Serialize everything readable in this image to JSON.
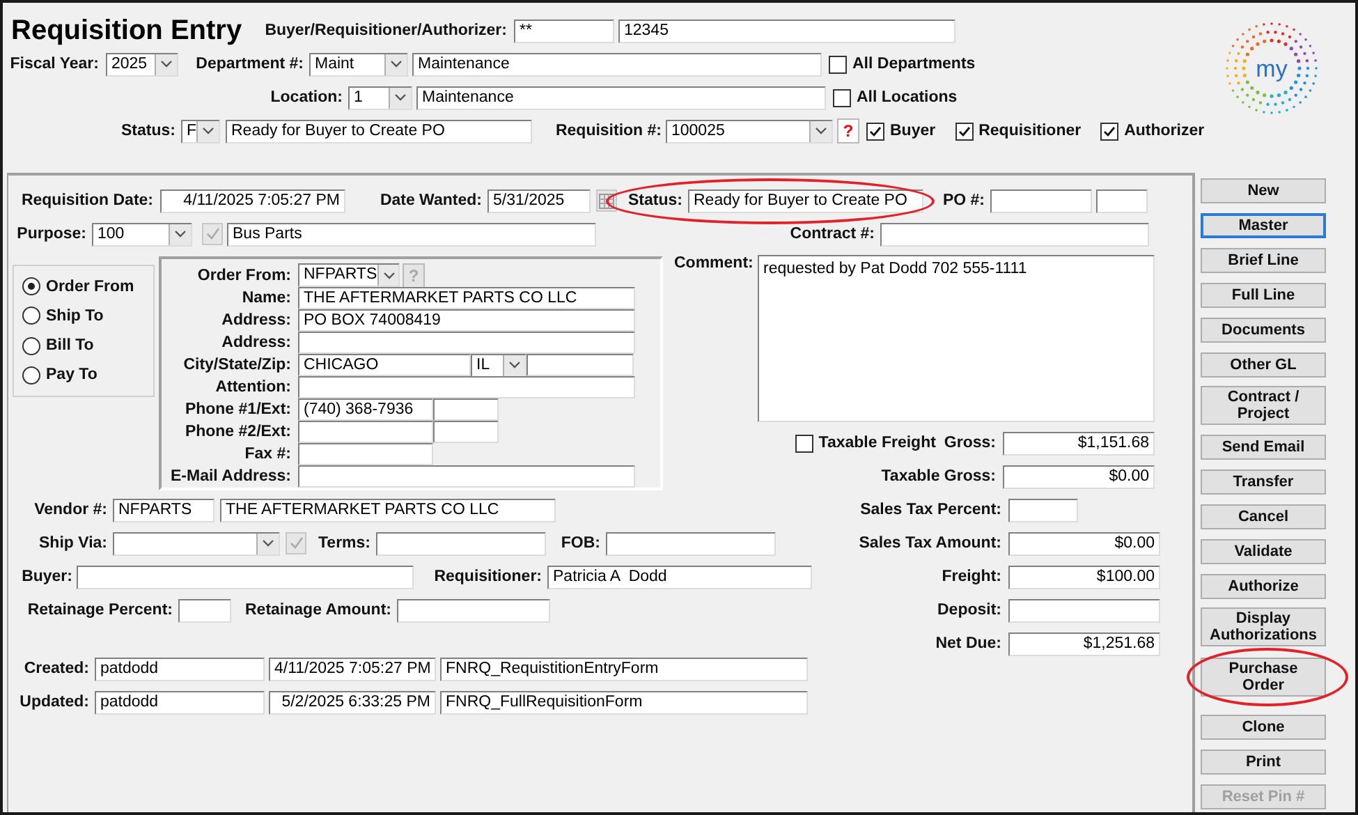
{
  "header": {
    "title": "Requisition Entry",
    "buyer": {
      "label": "Buyer/Requisitioner/Authorizer:",
      "code": "**",
      "id": "12345"
    },
    "fiscal_year": {
      "label": "Fiscal Year:",
      "value": "2025"
    },
    "department": {
      "label": "Department #:",
      "code": "Maint",
      "name": "Maintenance"
    },
    "all_departments": {
      "label": "All Departments",
      "checked": false
    },
    "location": {
      "label": "Location:",
      "code": "1",
      "name": "Maintenance"
    },
    "all_locations": {
      "label": "All Locations",
      "checked": false
    },
    "status": {
      "label": "Status:",
      "code": "F",
      "text": "Ready for Buyer to Create PO"
    },
    "requisition": {
      "label": "Requisition #:",
      "value": "100025",
      "help": "?"
    },
    "role_filters": [
      {
        "label": "Buyer",
        "checked": true
      },
      {
        "label": "Requisitioner",
        "checked": true
      },
      {
        "label": "Authorizer",
        "checked": true
      }
    ]
  },
  "logo": {
    "text": "my"
  },
  "form": {
    "requisition_date": {
      "label": "Requisition Date:",
      "value": "4/11/2025 7:05:27 PM"
    },
    "date_wanted": {
      "label": "Date Wanted:",
      "value": "5/31/2025"
    },
    "status": {
      "label": "Status:",
      "value": "Ready for Buyer to Create PO",
      "circled": true
    },
    "po": {
      "label": "PO #:"
    },
    "purpose": {
      "label": "Purpose:",
      "code": "100",
      "text": "Bus Parts"
    },
    "contract": {
      "label": "Contract #:"
    },
    "address_types": [
      {
        "label": "Order From",
        "selected": true
      },
      {
        "label": "Ship To",
        "selected": false
      },
      {
        "label": "Bill To",
        "selected": false
      },
      {
        "label": "Pay To",
        "selected": false
      }
    ],
    "address": {
      "order_from": {
        "label": "Order From:",
        "value": "NFPARTS",
        "help": "?"
      },
      "rows": [
        {
          "kind": "text",
          "label": "Name:",
          "value": "THE AFTERMARKET PARTS CO LLC"
        },
        {
          "kind": "text",
          "label": "Address:",
          "value": "PO BOX 74008419"
        },
        {
          "kind": "text",
          "label": "Address:"
        },
        {
          "kind": "city",
          "label": "City/State/Zip:",
          "city": "CHICAGO",
          "state": "IL"
        },
        {
          "kind": "text",
          "label": "Attention:"
        },
        {
          "kind": "phone",
          "label": "Phone #1/Ext:",
          "value": "(740) 368-7936"
        },
        {
          "kind": "phone",
          "label": "Phone #2/Ext:"
        },
        {
          "kind": "fax",
          "label": "Fax #:"
        },
        {
          "kind": "text",
          "label": "E-Mail Address:"
        }
      ]
    },
    "comment": {
      "label": "Comment:",
      "value": "requested by Pat Dodd 702 555-1111"
    },
    "taxable_freight": {
      "label": "Taxable Freight",
      "checked": false
    },
    "totals": [
      {
        "kind": "full",
        "label": "Gross:",
        "value": "$1,151.68"
      },
      {
        "kind": "full",
        "label": "Taxable Gross:",
        "value": "$0.00"
      },
      {
        "kind": "short",
        "label": "Sales Tax Percent:"
      },
      {
        "kind": "full",
        "label": "Sales Tax Amount:",
        "value": "$0.00"
      },
      {
        "kind": "full",
        "label": "Freight:",
        "value": "$100.00"
      },
      {
        "kind": "full",
        "label": "Deposit:"
      },
      {
        "kind": "full",
        "label": "Net Due:",
        "value": "$1,251.68"
      }
    ],
    "vendor": {
      "label": "Vendor #:",
      "code": "NFPARTS",
      "name": "THE AFTERMARKET PARTS CO LLC"
    },
    "ship_via": {
      "label": "Ship Via:"
    },
    "terms": {
      "label": "Terms:"
    },
    "fob": {
      "label": "FOB:"
    },
    "buyer": {
      "label": "Buyer:"
    },
    "requisitioner": {
      "label": "Requisitioner:",
      "value": "Patricia A  Dodd"
    },
    "retainage_percent": {
      "label": "Retainage Percent:"
    },
    "retainage_amount": {
      "label": "Retainage Amount:"
    },
    "audit": [
      {
        "label": "Created:",
        "user": "patdodd",
        "time": "4/11/2025 7:05:27 PM",
        "form": "FNRQ_RequistitionEntryForm"
      },
      {
        "label": "Updated:",
        "user": "patdodd",
        "time": "5/2/2025 6:33:25 PM",
        "form": "FNRQ_FullRequisitionForm"
      }
    ]
  },
  "buttons": [
    {
      "label": "New",
      "focused": false,
      "circled": false,
      "disabled": false
    },
    {
      "label": "Master",
      "focused": true,
      "circled": false,
      "disabled": false
    },
    {
      "label": "Brief Line",
      "focused": false,
      "circled": false,
      "disabled": false
    },
    {
      "label": "Full Line",
      "focused": false,
      "circled": false,
      "disabled": false
    },
    {
      "label": "Documents",
      "focused": false,
      "circled": false,
      "disabled": false
    },
    {
      "label": "Other GL",
      "focused": false,
      "circled": false,
      "disabled": false
    },
    {
      "label": "Contract / Project",
      "focused": false,
      "circled": false,
      "disabled": false
    },
    {
      "label": "Send Email",
      "focused": false,
      "circled": false,
      "disabled": false
    },
    {
      "label": "Transfer",
      "focused": false,
      "circled": false,
      "disabled": false
    },
    {
      "label": "Cancel",
      "focused": false,
      "circled": false,
      "disabled": false
    },
    {
      "label": "Validate",
      "focused": false,
      "circled": false,
      "disabled": false
    },
    {
      "label": "Authorize",
      "focused": false,
      "circled": false,
      "disabled": false
    },
    {
      "label": "Display Authorizations",
      "focused": false,
      "circled": false,
      "disabled": false
    },
    {
      "label": "Purchase Order",
      "focused": false,
      "circled": true,
      "disabled": false
    },
    {
      "label": "Clone",
      "focused": false,
      "circled": false,
      "disabled": false
    },
    {
      "label": "Print",
      "focused": false,
      "circled": false,
      "disabled": false
    },
    {
      "label": "Reset Pin #",
      "focused": false,
      "circled": false,
      "disabled": true
    }
  ]
}
